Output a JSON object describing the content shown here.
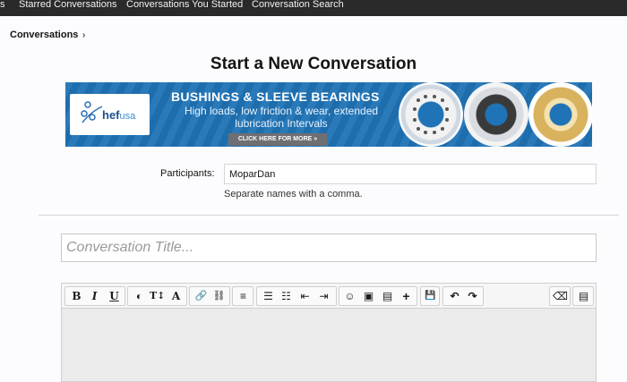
{
  "nav": {
    "items": [
      "s",
      "Starred Conversations",
      "Conversations You Started",
      "Conversation Search"
    ]
  },
  "breadcrumb": {
    "label": "Conversations",
    "chevron": "›"
  },
  "page": {
    "title": "Start a New Conversation"
  },
  "banner": {
    "brand": "hef",
    "brand_suffix": "usa",
    "headline": "BUSHINGS & SLEEVE BEARINGS",
    "subline": "High loads, low friction & wear, extended lubrication Intervals",
    "cta": "CLICK HERE FOR MORE »",
    "colors": {
      "background": "#1f73b6",
      "cta": "#6e6f73"
    }
  },
  "form": {
    "participants_label": "Participants:",
    "participants_value": "MoparDan",
    "participants_hint": "Separate names with a comma.",
    "title_placeholder": "Conversation Title..."
  },
  "toolbar": {
    "bold": "B",
    "italic": "I",
    "underline": "U",
    "color": "◐",
    "size": "T↕",
    "font": "A",
    "link": "🔗",
    "unlink": "⛓",
    "align": "≡",
    "bullets": "☰",
    "numbers": "☷",
    "outdent": "⇤",
    "indent": "⇥",
    "smilies": "☺",
    "image": "▣",
    "media": "▤",
    "insert": "+",
    "save": "💾",
    "undo": "↶",
    "redo": "↷",
    "remove_format": "⌫",
    "source": "▤"
  }
}
